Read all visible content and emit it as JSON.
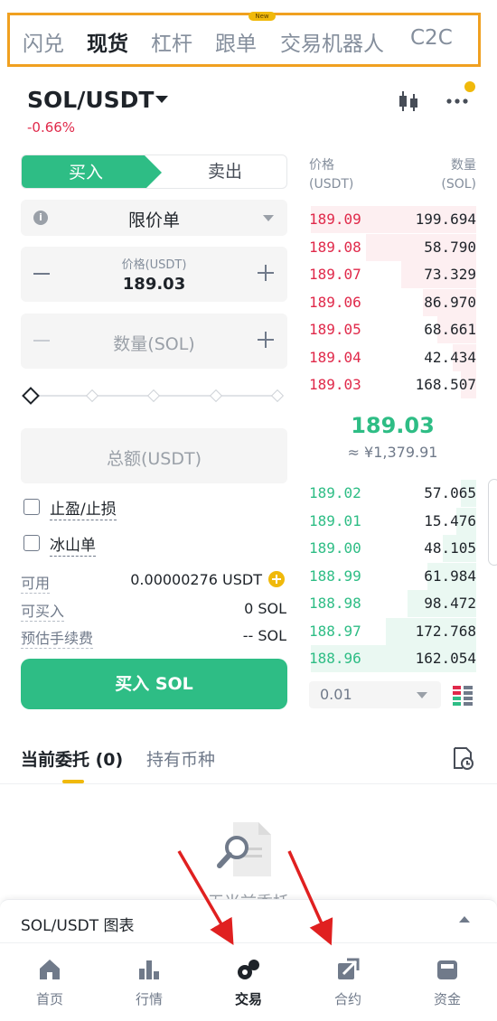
{
  "top_tabs": [
    {
      "label": "闪兑",
      "active": false
    },
    {
      "label": "现货",
      "active": true
    },
    {
      "label": "杠杆",
      "active": false
    },
    {
      "label": "跟单",
      "active": false
    },
    {
      "label": "交易机器人",
      "active": false
    },
    {
      "label": "C2C",
      "active": false
    }
  ],
  "header": {
    "pair": "SOL/USDT",
    "change": "-0.66%"
  },
  "trade_form": {
    "buy_label": "买入",
    "sell_label": "卖出",
    "order_type": "限价单",
    "price_label": "价格(USDT)",
    "price_value": "189.03",
    "quantity_placeholder": "数量(SOL)",
    "total_placeholder": "总额(USDT)",
    "tp_sl_label": "止盈/止损",
    "iceberg_label": "冰山单",
    "available_label": "可用",
    "available_value": "0.00000276 USDT",
    "can_buy_label": "可买入",
    "can_buy_value": "0 SOL",
    "fee_label": "预估手续费",
    "fee_value": "-- SOL",
    "submit_label": "买入 SOL"
  },
  "order_book": {
    "price_header": "价格",
    "price_unit": "(USDT)",
    "qty_header": "数量",
    "qty_unit": "(SOL)",
    "asks": [
      {
        "price": "189.09",
        "qty": "199.694",
        "depth": 0.99
      },
      {
        "price": "189.08",
        "qty": "58.790",
        "depth": 0.66
      },
      {
        "price": "189.07",
        "qty": "73.329",
        "depth": 0.45
      },
      {
        "price": "189.06",
        "qty": "86.970",
        "depth": 0.32
      },
      {
        "price": "189.05",
        "qty": "68.661",
        "depth": 0.23
      },
      {
        "price": "189.04",
        "qty": "42.434",
        "depth": 0.14
      },
      {
        "price": "189.03",
        "qty": "168.507",
        "depth": 0.09
      }
    ],
    "last_price": "189.03",
    "last_price_cny": "≈ ¥1,379.91",
    "bids": [
      {
        "price": "189.02",
        "qty": "57.065",
        "depth": 0.09
      },
      {
        "price": "189.01",
        "qty": "15.476",
        "depth": 0.12
      },
      {
        "price": "189.00",
        "qty": "48.105",
        "depth": 0.2
      },
      {
        "price": "188.99",
        "qty": "61.984",
        "depth": 0.29
      },
      {
        "price": "188.98",
        "qty": "98.472",
        "depth": 0.41
      },
      {
        "price": "188.97",
        "qty": "172.768",
        "depth": 0.54
      },
      {
        "price": "188.96",
        "qty": "162.054",
        "depth": 0.99
      }
    ],
    "depth_step": "0.01"
  },
  "orders": {
    "tab_current": "当前委托 (0)",
    "tab_holdings": "持有币种",
    "empty_text": "无当前委托"
  },
  "chart_bar": {
    "label": "SOL/USDT 图表"
  },
  "bottom_nav": [
    {
      "label": "首页",
      "icon": "home-icon",
      "active": false
    },
    {
      "label": "行情",
      "icon": "markets-icon",
      "active": false
    },
    {
      "label": "交易",
      "icon": "trade-icon",
      "active": true
    },
    {
      "label": "合约",
      "icon": "futures-icon",
      "active": false
    },
    {
      "label": "资金",
      "icon": "wallet-icon",
      "active": false
    }
  ],
  "colors": {
    "buy_green": "#2ebd85",
    "sell_red": "#e0294a",
    "accent_yellow": "#f0b90b",
    "highlight_box": "#f0a020",
    "annotation_arrow": "#e02020"
  }
}
